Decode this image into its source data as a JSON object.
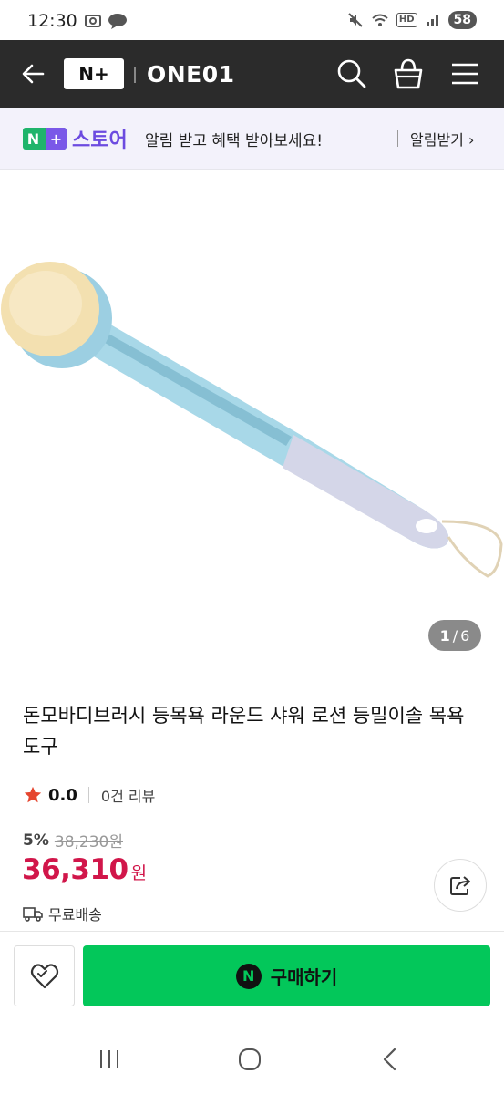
{
  "status": {
    "time": "12:30",
    "hd": "HD",
    "battery": "58"
  },
  "appbar": {
    "logo_text": "N+",
    "store_name": "ONE01"
  },
  "banner": {
    "logo_text": "N",
    "logo_plus": "+",
    "store_label": "스토어",
    "message": "알림 받고 혜택 받아보세요!",
    "link_label": "알림받기 ›"
  },
  "gallery": {
    "current": "1",
    "separator": "/",
    "total": "6"
  },
  "product": {
    "title": "돈모바디브러시 등목욕 라운드 샤워 로션 등밀이솔 목욕도구",
    "rating": "0.0",
    "review_count": "0건 리뷰",
    "discount_rate": "5%",
    "original_price": "38,230원",
    "price": "36,310",
    "price_unit": "원",
    "shipping": "무료배송"
  },
  "bottom": {
    "buy_label": "구매하기",
    "naver_letter": "N"
  },
  "colors": {
    "appbar_bg": "#2b2b2b",
    "price_red": "#d1164a",
    "buy_green": "#03c75a",
    "banner_purple": "#6c4be0"
  }
}
